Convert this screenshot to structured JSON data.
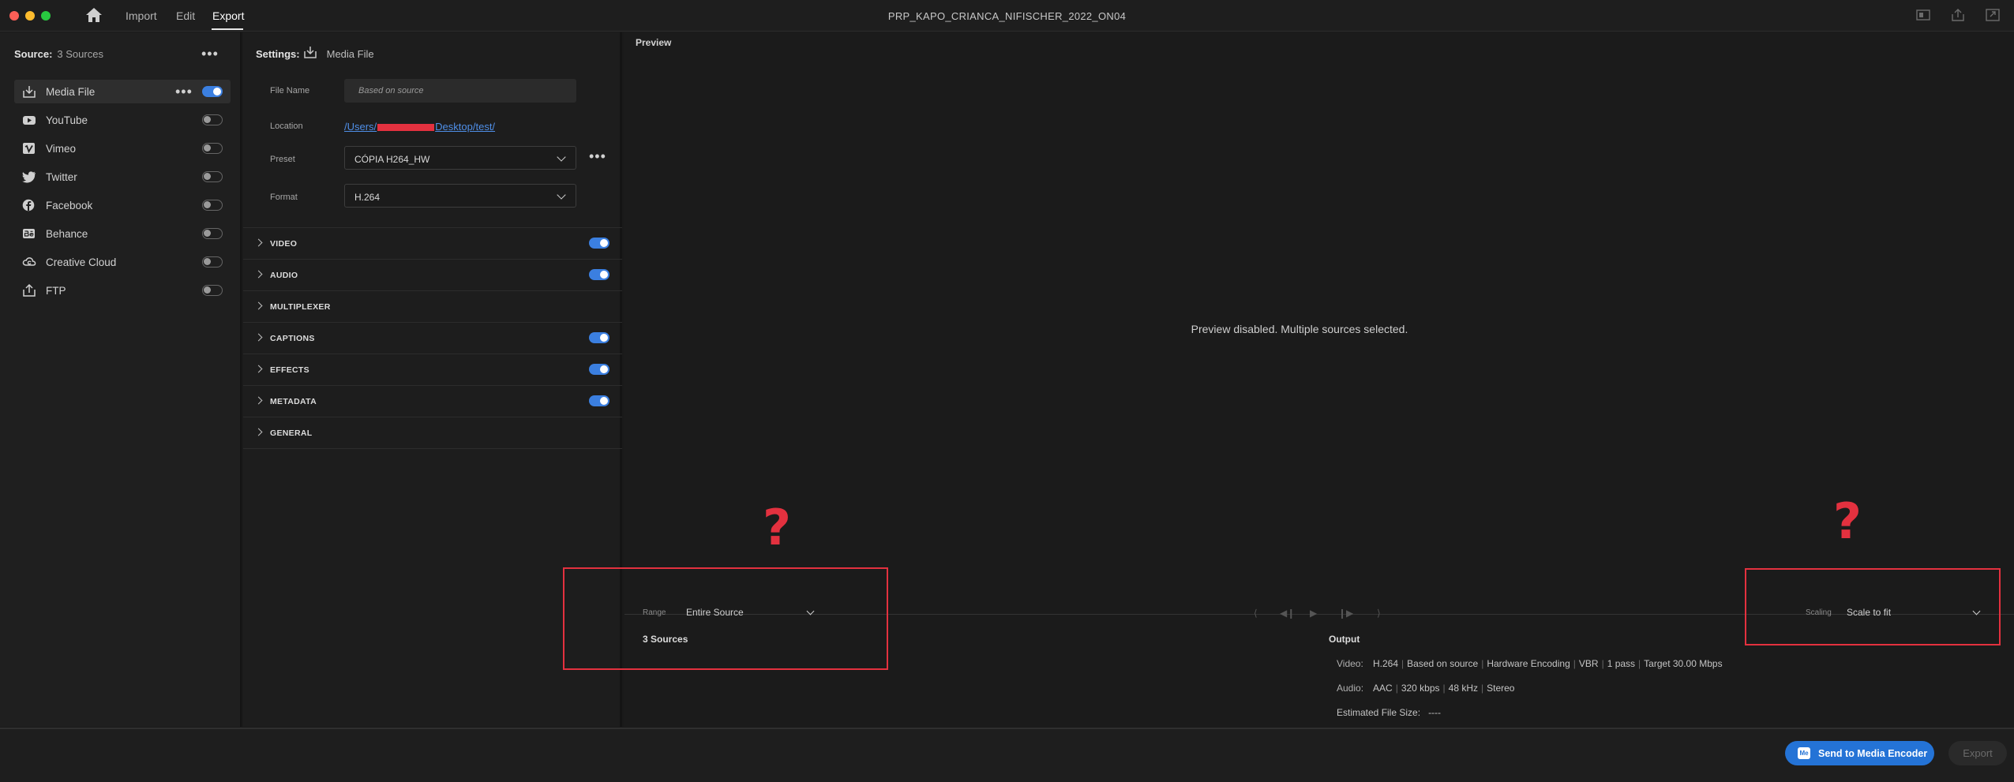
{
  "titlebar": {
    "nav": [
      "Import",
      "Edit",
      "Export"
    ],
    "active_tab": "Export",
    "doc_title": "PRP_KAPO_CRIANCA_NIFISCHER_2022_ON04"
  },
  "source_panel": {
    "label": "Source:",
    "count": "3 Sources",
    "destinations": [
      {
        "label": "Media File",
        "enabled": true,
        "selected": true,
        "icon": "download-icon"
      },
      {
        "label": "YouTube",
        "enabled": false,
        "icon": "youtube-icon"
      },
      {
        "label": "Vimeo",
        "enabled": false,
        "icon": "vimeo-icon"
      },
      {
        "label": "Twitter",
        "enabled": false,
        "icon": "twitter-icon"
      },
      {
        "label": "Facebook",
        "enabled": false,
        "icon": "facebook-icon"
      },
      {
        "label": "Behance",
        "enabled": false,
        "icon": "behance-icon"
      },
      {
        "label": "Creative Cloud",
        "enabled": false,
        "icon": "creative-cloud-icon"
      },
      {
        "label": "FTP",
        "enabled": false,
        "icon": "upload-icon"
      }
    ]
  },
  "settings": {
    "label": "Settings:",
    "target": "Media File",
    "file_name_label": "File Name",
    "file_name_placeholder": "Based on source",
    "location_label": "Location",
    "location_prefix": "/Users/",
    "location_suffix": "Desktop/test/",
    "preset_label": "Preset",
    "preset_value": "CÓPIA H264_HW",
    "format_label": "Format",
    "format_value": "H.264",
    "sections": [
      {
        "name": "VIDEO",
        "toggle": true
      },
      {
        "name": "AUDIO",
        "toggle": true
      },
      {
        "name": "MULTIPLEXER",
        "toggle": null
      },
      {
        "name": "CAPTIONS",
        "toggle": true
      },
      {
        "name": "EFFECTS",
        "toggle": true
      },
      {
        "name": "METADATA",
        "toggle": true
      },
      {
        "name": "GENERAL",
        "toggle": null
      }
    ]
  },
  "preview": {
    "title": "Preview",
    "message": "Preview disabled.  Multiple sources selected.",
    "range_label": "Range",
    "range_value": "Entire Source",
    "scaling_label": "Scaling",
    "scaling_value": "Scale to fit",
    "sources_summary": "3 Sources"
  },
  "output": {
    "title": "Output",
    "video_label": "Video:",
    "video_parts": [
      "H.264",
      "Based on source",
      "Hardware Encoding",
      "VBR",
      "1 pass",
      "Target 30.00 Mbps"
    ],
    "audio_label": "Audio:",
    "audio_parts": [
      "AAC",
      "320 kbps",
      "48 kHz",
      "Stereo"
    ],
    "size_label": "Estimated File Size:",
    "size_value": "----"
  },
  "annotations": {
    "mark": "?",
    "color": "#e3313f"
  },
  "footer": {
    "send_button": "Send to Media Encoder",
    "send_icon_text": "Me",
    "export_button": "Export"
  },
  "colors": {
    "accent": "#3b7fe0",
    "link": "#4f8fe8",
    "primary_button": "#2473d6"
  }
}
